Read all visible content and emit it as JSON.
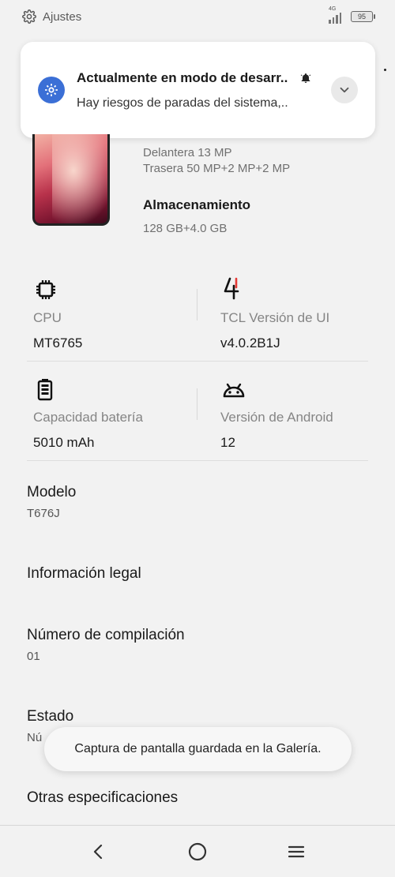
{
  "status_bar": {
    "app_label": "Ajustes",
    "network": "4G",
    "battery": "95"
  },
  "notification": {
    "title": "Actualmente en modo de desarr..",
    "text": "Hay riesgos de paradas del sistema,.."
  },
  "camera": {
    "front": "Delantera  13 MP",
    "rear": "Trasera  50 MP+2 MP+2 MP"
  },
  "storage": {
    "title": "Almacenamiento",
    "value": "128 GB+4.0 GB"
  },
  "specs": {
    "cpu": {
      "label": "CPU",
      "value": "MT6765",
      "icon": "chip-icon"
    },
    "ui": {
      "label": "TCL Versión de UI",
      "value": "v4.0.2B1J",
      "icon": "tcl-ui-icon"
    },
    "battery": {
      "label": "Capacidad batería",
      "value": "5010 mAh",
      "icon": "battery-icon"
    },
    "android": {
      "label": "Versión de Android",
      "value": "12",
      "icon": "android-icon"
    }
  },
  "rows": {
    "model": {
      "title": "Modelo",
      "sub": "T676J"
    },
    "legal": {
      "title": "Información legal"
    },
    "build": {
      "title": "Número de compilación",
      "sub": "01"
    },
    "status": {
      "title": "Estado",
      "sub": "Nú"
    },
    "other": {
      "title": "Otras especificaciones"
    }
  },
  "toast": {
    "text": "Captura de pantalla guardada en la Galería."
  },
  "colors": {
    "accent": "#3b6fd6",
    "background": "#f2f2f2",
    "ui_red": "#e53935"
  }
}
